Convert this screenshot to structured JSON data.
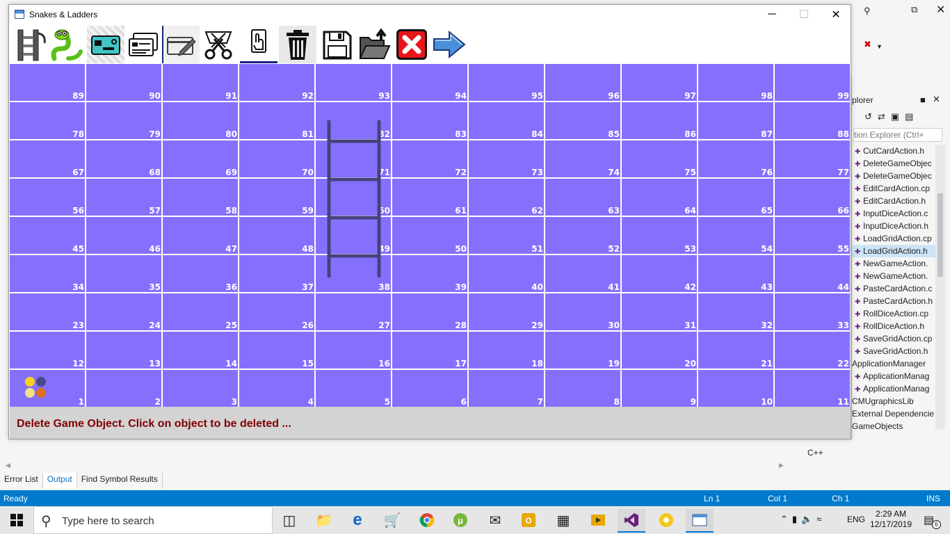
{
  "window": {
    "title": "Snakes & Ladders",
    "minimize": "─",
    "maximize": "☐",
    "close": "✕"
  },
  "toolbar": [
    {
      "name": "add-ladder-tool",
      "icon": "ladder-icon"
    },
    {
      "name": "add-snake-tool",
      "icon": "snake-icon"
    },
    {
      "name": "add-card-tool",
      "icon": "card-icon"
    },
    {
      "name": "copy-card-tool",
      "icon": "copy-card-icon"
    },
    {
      "name": "edit-card-tool",
      "icon": "edit-card-icon"
    },
    {
      "name": "cut-card-tool",
      "icon": "scissors-icon"
    },
    {
      "name": "paste-card-tool",
      "icon": "paste-icon"
    },
    {
      "name": "delete-object-tool",
      "icon": "trash-icon"
    },
    {
      "name": "save-grid-tool",
      "icon": "save-icon"
    },
    {
      "name": "load-grid-tool",
      "icon": "open-folder-icon"
    },
    {
      "name": "exit-tool",
      "icon": "exit-icon"
    },
    {
      "name": "switch-to-play-mode-tool",
      "icon": "arrow-right-icon"
    }
  ],
  "board": {
    "cell_color": "#8570fe",
    "rows": [
      [
        "89",
        "90",
        "91",
        "92",
        "93",
        "94",
        "95",
        "96",
        "97",
        "98",
        "99"
      ],
      [
        "78",
        "79",
        "80",
        "81",
        "82",
        "83",
        "84",
        "85",
        "86",
        "87",
        "88"
      ],
      [
        "67",
        "68",
        "69",
        "70",
        "71",
        "72",
        "73",
        "74",
        "75",
        "76",
        "77"
      ],
      [
        "56",
        "57",
        "58",
        "59",
        "60",
        "61",
        "62",
        "63",
        "64",
        "65",
        "66"
      ],
      [
        "45",
        "46",
        "47",
        "48",
        "49",
        "50",
        "51",
        "52",
        "53",
        "54",
        "55"
      ],
      [
        "34",
        "35",
        "36",
        "37",
        "38",
        "39",
        "40",
        "41",
        "42",
        "43",
        "44"
      ],
      [
        "23",
        "24",
        "25",
        "26",
        "27",
        "28",
        "29",
        "30",
        "31",
        "32",
        "33"
      ],
      [
        "12",
        "13",
        "14",
        "15",
        "16",
        "17",
        "18",
        "19",
        "20",
        "21",
        "22"
      ],
      [
        "1",
        "2",
        "3",
        "4",
        "5",
        "6",
        "7",
        "8",
        "9",
        "10",
        "11"
      ]
    ],
    "player_colors": [
      "#f5d31c",
      "#4a4a8a",
      "#f0e08a",
      "#e07020"
    ],
    "ladder_color": "#47427a"
  },
  "status_message": "Delete Game Object. Click on object to be deleted ...",
  "ide": {
    "solution_explorer_title": "plorer",
    "solution_explorer_search": "tion Explorer (Ctrl+",
    "solution_items": [
      {
        "label": "CutCardAction.h",
        "child": true,
        "selected": false
      },
      {
        "label": "DeleteGameObjec",
        "child": true,
        "selected": false
      },
      {
        "label": "DeleteGameObjec",
        "child": true,
        "selected": false
      },
      {
        "label": "EditCardAction.cp",
        "child": true,
        "selected": false
      },
      {
        "label": "EditCardAction.h",
        "child": true,
        "selected": false
      },
      {
        "label": "InputDiceAction.c",
        "child": true,
        "selected": false
      },
      {
        "label": "InputDiceAction.h",
        "child": true,
        "selected": false
      },
      {
        "label": "LoadGridAction.cp",
        "child": true,
        "selected": false
      },
      {
        "label": "LoadGridAction.h",
        "child": true,
        "selected": true
      },
      {
        "label": "NewGameAction.",
        "child": true,
        "selected": false
      },
      {
        "label": "NewGameAction.",
        "child": true,
        "selected": false
      },
      {
        "label": "PasteCardAction.c",
        "child": true,
        "selected": false
      },
      {
        "label": "PasteCardAction.h",
        "child": true,
        "selected": false
      },
      {
        "label": "RollDiceAction.cp",
        "child": true,
        "selected": false
      },
      {
        "label": "RollDiceAction.h",
        "child": true,
        "selected": false
      },
      {
        "label": "SaveGridAction.cp",
        "child": true,
        "selected": false
      },
      {
        "label": "SaveGridAction.h",
        "child": true,
        "selected": false
      },
      {
        "label": "ApplicationManager",
        "child": false,
        "selected": false
      },
      {
        "label": "ApplicationManag",
        "child": true,
        "selected": false
      },
      {
        "label": "ApplicationManag",
        "child": true,
        "selected": false
      },
      {
        "label": "CMUgraphicsLib",
        "child": false,
        "selected": false
      },
      {
        "label": "External Dependencie",
        "child": false,
        "selected": false
      },
      {
        "label": "GameObjects",
        "child": false,
        "selected": false
      }
    ],
    "properties_language": "C++",
    "output_tabs": [
      {
        "label": "Error List",
        "active": false
      },
      {
        "label": "Output",
        "active": true
      },
      {
        "label": "Find Symbol Results",
        "active": false
      }
    ],
    "status": {
      "ready": "Ready",
      "ln": "Ln 1",
      "col": "Col 1",
      "ch": "Ch 1",
      "ins": "INS"
    }
  },
  "taskbar": {
    "search_placeholder": "Type here to search",
    "language": "ENG",
    "time": "2:29 AM",
    "date": "12/17/2019",
    "notification_count": "6"
  }
}
